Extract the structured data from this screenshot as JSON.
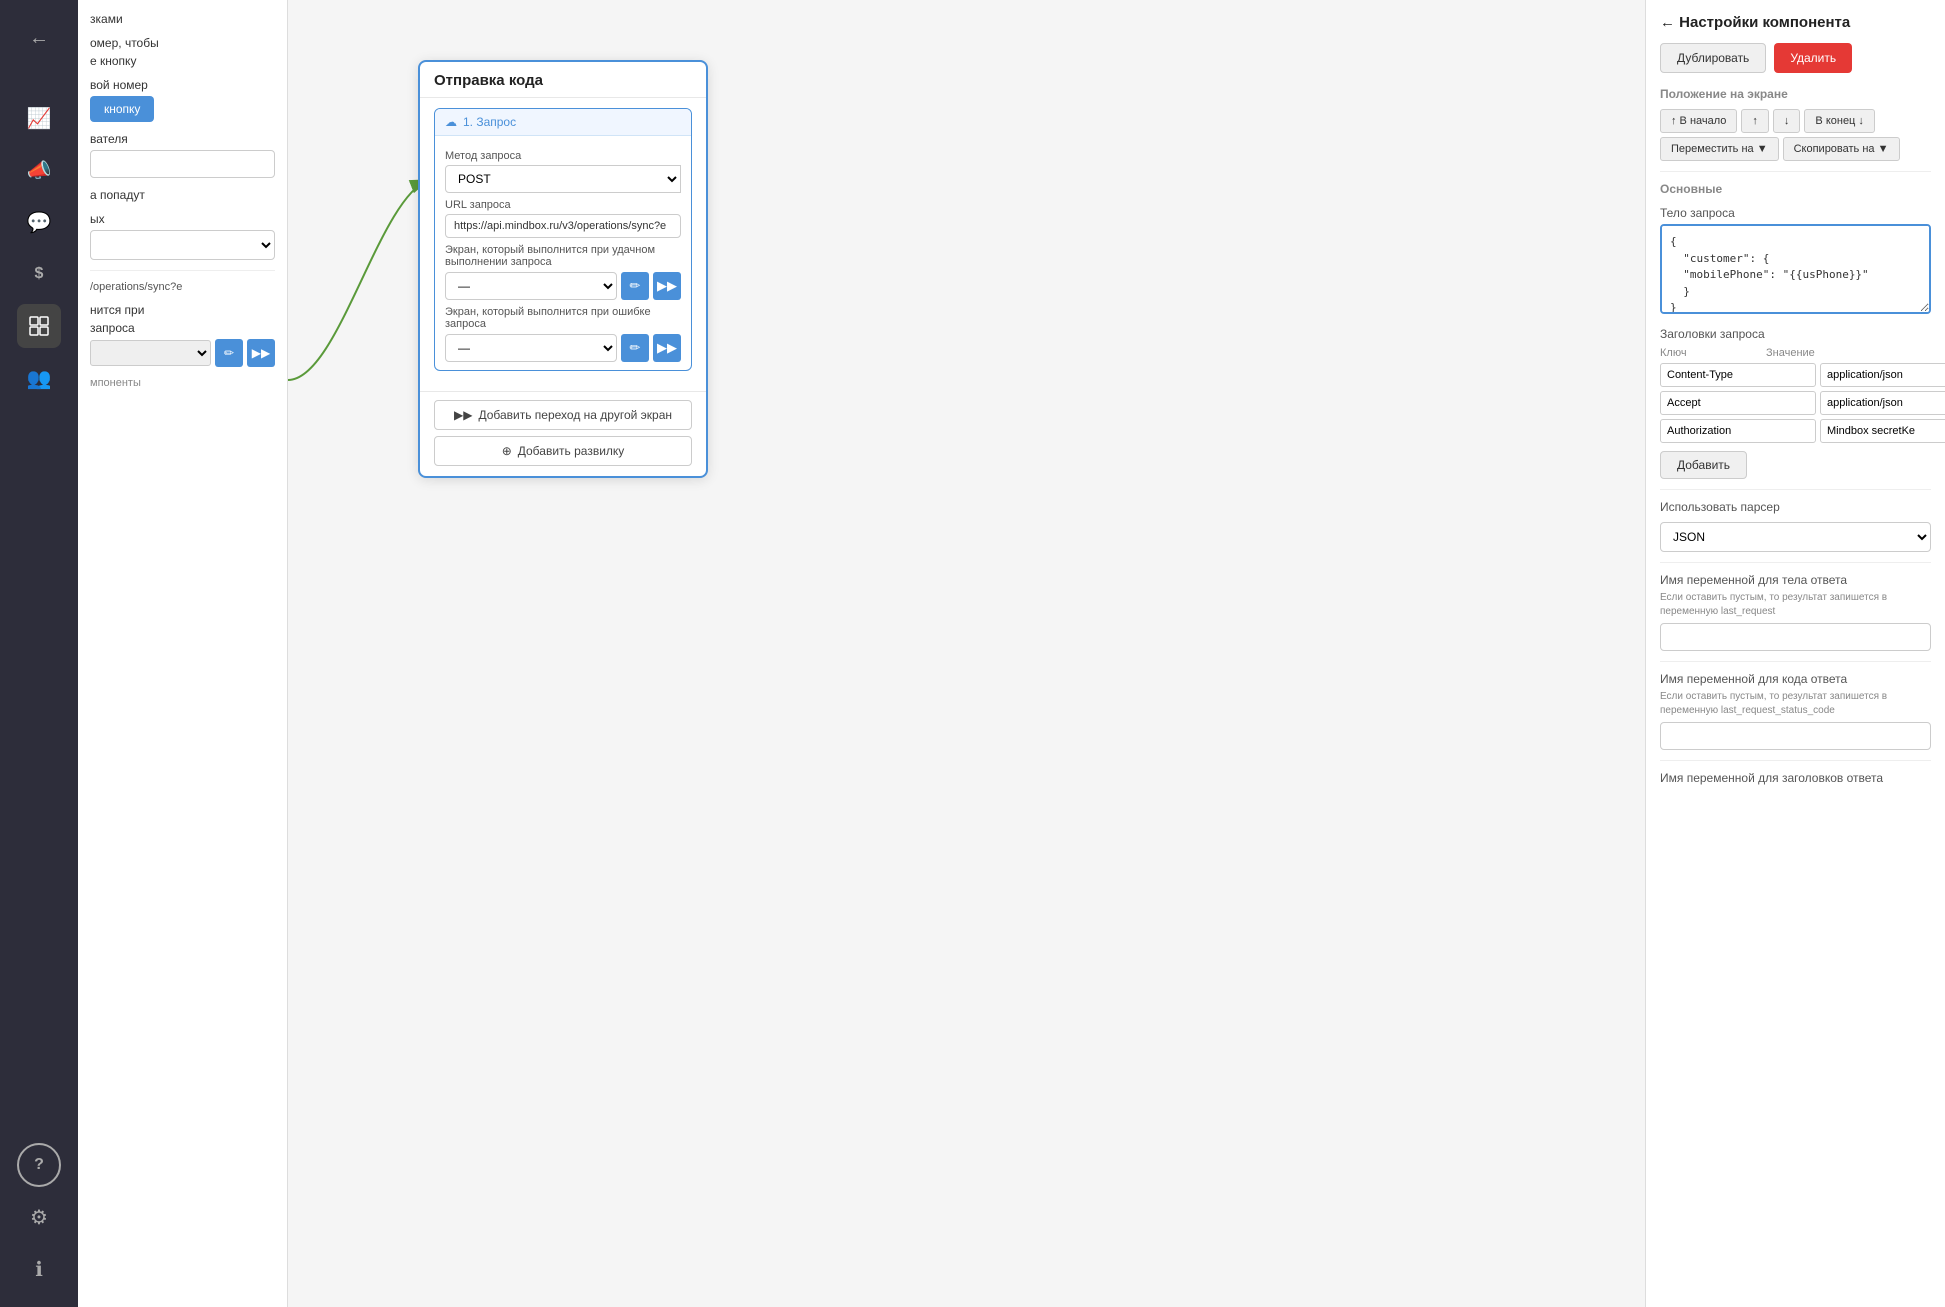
{
  "sidebar": {
    "icons": [
      {
        "name": "back-icon",
        "symbol": "←",
        "active": false
      },
      {
        "name": "analytics-icon",
        "symbol": "📈",
        "active": false
      },
      {
        "name": "megaphone-icon",
        "symbol": "📢",
        "active": false
      },
      {
        "name": "chat-icon",
        "symbol": "💬",
        "active": false
      },
      {
        "name": "dollar-icon",
        "symbol": "$",
        "active": false
      },
      {
        "name": "layout-icon",
        "symbol": "⊞",
        "active": true
      },
      {
        "name": "users-icon",
        "symbol": "👥",
        "active": false
      },
      {
        "name": "help-icon",
        "symbol": "?",
        "active": false
      },
      {
        "name": "settings-icon",
        "symbol": "⚙",
        "active": false
      },
      {
        "name": "info-icon",
        "symbol": "ⓘ",
        "active": false
      }
    ]
  },
  "left_panel": {
    "sections": [
      {
        "label": "зками",
        "type": "text"
      },
      {
        "label": "омер, чтобы",
        "type": "text"
      },
      {
        "label": "е кнопку",
        "type": "text"
      },
      {
        "label": "вой номер",
        "type": "text"
      },
      {
        "label": "кнопку",
        "type": "button",
        "value": "кнопку"
      },
      {
        "label": "вателя",
        "type": "text"
      },
      {
        "label": "а попадут",
        "type": "text"
      },
      {
        "label": "ых",
        "type": "text"
      }
    ],
    "url_text": "/operations/sync?e",
    "screen_text1": "нится при",
    "screen_text2": "запроса",
    "components_label": "мпоненты"
  },
  "card": {
    "title": "Отправка кода",
    "request_label": "1. Запрос",
    "method_label": "Метод запроса",
    "method_value": "POST",
    "url_label": "URL запроса",
    "url_value": "https://api.mindbox.ru/v3/operations/sync?e",
    "screen_success_label": "Экран, который выполнится при удачном выполнении запроса",
    "screen_success_value": "—",
    "screen_error_label": "Экран, который выполнится при ошибке запроса",
    "screen_error_value": "—",
    "add_transition_btn": "Добавить переход на другой экран",
    "add_branch_btn": "Добавить развилку"
  },
  "right_panel": {
    "title": "← Настройки компонента",
    "btn_dup": "Дублировать",
    "btn_del": "Удалить",
    "position_section": "Положение на экране",
    "position_btns": [
      "↑ В начало",
      "↑",
      "↓",
      "В конец ↓",
      "Переместить на ▼",
      "Скопировать на ▼"
    ],
    "basics_section": "Основные",
    "body_label": "Тело запроса",
    "body_value": "{\n  \"customer\": {\n  \"mobilePhone\": \"{{usPhone}}\"\n  }\n}",
    "headers_section": "Заголовки запроса",
    "headers_key_col": "Ключ",
    "headers_val_col": "Значение",
    "headers": [
      {
        "key": "Content-Type",
        "value": "application/json"
      },
      {
        "key": "Accept",
        "value": "application/json"
      },
      {
        "key": "Authorization",
        "value": "Mindbox secretKe"
      }
    ],
    "add_header_btn": "Добавить",
    "parser_label": "Использовать парсер",
    "parser_value": "JSON",
    "var_body_label": "Имя переменной для тела ответа",
    "var_body_hint": "Если оставить пустым, то результат запишется в переменную last_request",
    "var_body_value": "",
    "var_code_label": "Имя переменной для кода ответа",
    "var_code_hint": "Если оставить пустым, то результат запишется в переменную last_request_status_code",
    "var_code_value": "",
    "var_headers_label": "Имя переменной для заголовков ответа"
  }
}
